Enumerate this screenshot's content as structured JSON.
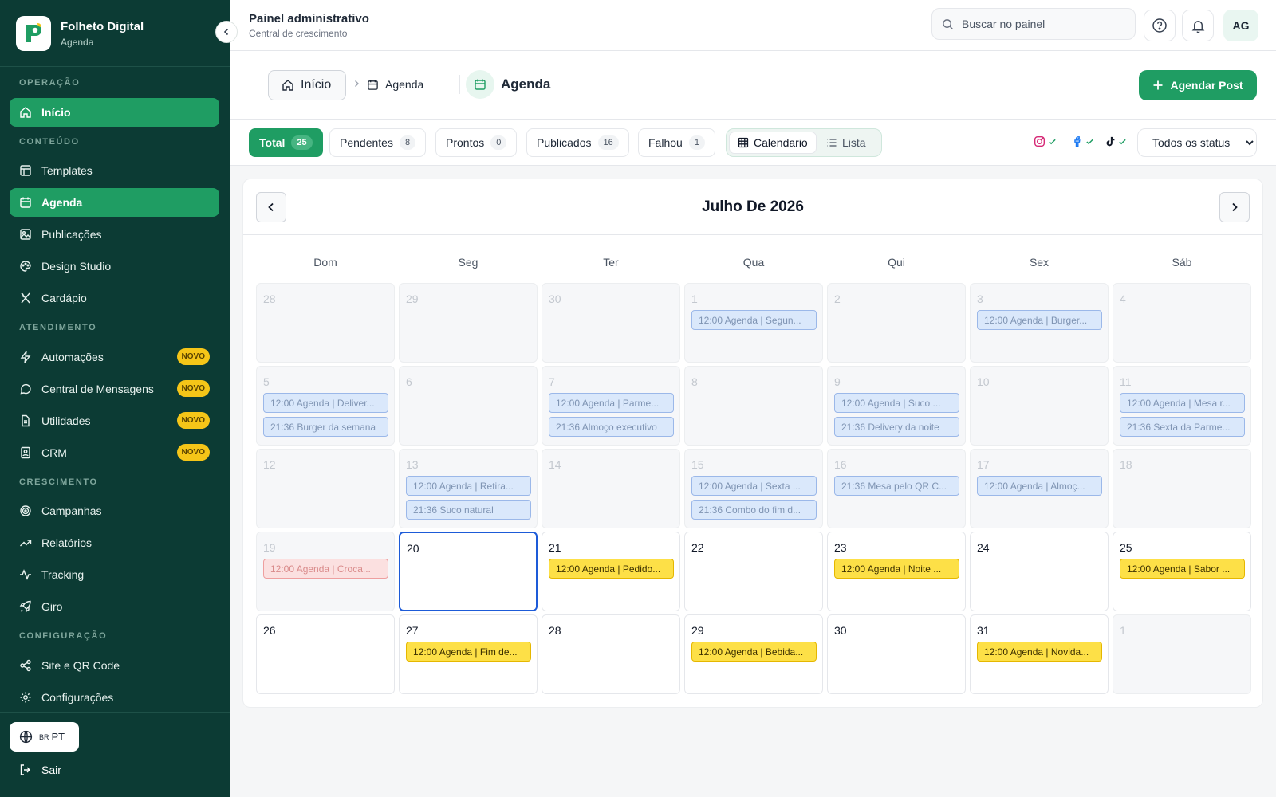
{
  "sidebar": {
    "brand_title": "Folheto Digital",
    "brand_sub": "Agenda",
    "sections": {
      "operacao": "OPERAÇÃO",
      "conteudo": "CONTEÚDO",
      "atendimento": "ATENDIMENTO",
      "crescimento": "CRESCIMENTO",
      "configuracao": "CONFIGURAÇÃO"
    },
    "items": {
      "inicio": "Início",
      "templates": "Templates",
      "agenda": "Agenda",
      "publicacoes": "Publicações",
      "design_studio": "Design Studio",
      "cardapio": "Cardápio",
      "automacoes": "Automações",
      "central_mensagens": "Central de Mensagens",
      "utilidades": "Utilidades",
      "crm": "CRM",
      "campanhas": "Campanhas",
      "relatorios": "Relatórios",
      "tracking": "Tracking",
      "giro": "Giro",
      "site_qr": "Site e QR Code",
      "configuracoes": "Configurações"
    },
    "badge_novo": "NOVO",
    "lang_flag": "BR",
    "lang_code": "PT",
    "logout": "Sair"
  },
  "header": {
    "title": "Painel administrativo",
    "subtitle": "Central de crescimento",
    "search_placeholder": "Buscar no painel",
    "avatar": "AG"
  },
  "subheader": {
    "crumb_home": "Início",
    "crumb_current": "Agenda",
    "page_title": "Agenda",
    "primary_button": "Agendar Post"
  },
  "filters": {
    "total_label": "Total",
    "total_count": "25",
    "pendentes_label": "Pendentes",
    "pendentes_count": "8",
    "prontos_label": "Prontos",
    "prontos_count": "0",
    "publicados_label": "Publicados",
    "publicados_count": "16",
    "falhou_label": "Falhou",
    "falhou_count": "1",
    "view_calendar": "Calendario",
    "view_list": "Lista",
    "status_selected": "Todos os status"
  },
  "calendar": {
    "month_title": "Julho De 2026",
    "weekdays": [
      "Dom",
      "Seg",
      "Ter",
      "Qua",
      "Qui",
      "Sex",
      "Sáb"
    ],
    "days": [
      {
        "num": "28",
        "state": "other",
        "events": []
      },
      {
        "num": "29",
        "state": "other",
        "events": []
      },
      {
        "num": "30",
        "state": "other",
        "events": []
      },
      {
        "num": "1",
        "state": "past",
        "events": [
          {
            "text": "12:00 Agenda | Segun...",
            "color": "blue"
          }
        ]
      },
      {
        "num": "2",
        "state": "past",
        "events": []
      },
      {
        "num": "3",
        "state": "past",
        "events": [
          {
            "text": "12:00 Agenda | Burger...",
            "color": "blue"
          }
        ]
      },
      {
        "num": "4",
        "state": "past",
        "events": []
      },
      {
        "num": "5",
        "state": "past",
        "events": [
          {
            "text": "12:00 Agenda | Deliver...",
            "color": "blue"
          },
          {
            "text": "21:36 Burger da semana",
            "color": "blue"
          }
        ]
      },
      {
        "num": "6",
        "state": "past",
        "events": []
      },
      {
        "num": "7",
        "state": "past",
        "events": [
          {
            "text": "12:00 Agenda | Parme...",
            "color": "blue"
          },
          {
            "text": "21:36 Almoço executivo",
            "color": "blue"
          }
        ]
      },
      {
        "num": "8",
        "state": "past",
        "events": []
      },
      {
        "num": "9",
        "state": "past",
        "events": [
          {
            "text": "12:00 Agenda | Suco ...",
            "color": "blue"
          },
          {
            "text": "21:36 Delivery da noite",
            "color": "blue"
          }
        ]
      },
      {
        "num": "10",
        "state": "past",
        "events": []
      },
      {
        "num": "11",
        "state": "past",
        "events": [
          {
            "text": "12:00 Agenda | Mesa r...",
            "color": "blue"
          },
          {
            "text": "21:36 Sexta da Parme...",
            "color": "blue"
          }
        ]
      },
      {
        "num": "12",
        "state": "past",
        "events": []
      },
      {
        "num": "13",
        "state": "past",
        "events": [
          {
            "text": "12:00 Agenda | Retira...",
            "color": "blue"
          },
          {
            "text": "21:36 Suco natural",
            "color": "blue"
          }
        ]
      },
      {
        "num": "14",
        "state": "past",
        "events": []
      },
      {
        "num": "15",
        "state": "past",
        "events": [
          {
            "text": "12:00 Agenda | Sexta ...",
            "color": "blue"
          },
          {
            "text": "21:36 Combo do fim d...",
            "color": "blue"
          }
        ]
      },
      {
        "num": "16",
        "state": "past",
        "events": [
          {
            "text": "21:36 Mesa pelo QR C...",
            "color": "blue"
          }
        ]
      },
      {
        "num": "17",
        "state": "past",
        "events": [
          {
            "text": "12:00 Agenda | Almoç...",
            "color": "blue"
          }
        ]
      },
      {
        "num": "18",
        "state": "past",
        "events": []
      },
      {
        "num": "19",
        "state": "past",
        "events": [
          {
            "text": "12:00 Agenda | Croca...",
            "color": "red"
          }
        ]
      },
      {
        "num": "20",
        "state": "today",
        "events": []
      },
      {
        "num": "21",
        "state": "current",
        "events": [
          {
            "text": "12:00 Agenda | Pedido...",
            "color": "yellow"
          }
        ]
      },
      {
        "num": "22",
        "state": "current",
        "events": []
      },
      {
        "num": "23",
        "state": "current",
        "events": [
          {
            "text": "12:00 Agenda | Noite ...",
            "color": "yellow"
          }
        ]
      },
      {
        "num": "24",
        "state": "current",
        "events": []
      },
      {
        "num": "25",
        "state": "current",
        "events": [
          {
            "text": "12:00 Agenda | Sabor ...",
            "color": "yellow"
          }
        ]
      },
      {
        "num": "26",
        "state": "current",
        "events": []
      },
      {
        "num": "27",
        "state": "current",
        "events": [
          {
            "text": "12:00 Agenda | Fim de...",
            "color": "yellow"
          }
        ]
      },
      {
        "num": "28",
        "state": "current",
        "events": []
      },
      {
        "num": "29",
        "state": "current",
        "events": [
          {
            "text": "12:00 Agenda | Bebida...",
            "color": "yellow"
          }
        ]
      },
      {
        "num": "30",
        "state": "current",
        "events": []
      },
      {
        "num": "31",
        "state": "current",
        "events": [
          {
            "text": "12:00 Agenda | Novida...",
            "color": "yellow"
          }
        ]
      },
      {
        "num": "1",
        "state": "other",
        "events": []
      }
    ]
  },
  "colors": {
    "sidebar_bg": "#0c3b34",
    "accent": "#1f9d63",
    "today_border": "#1d5bd8",
    "badge": "#f5c518"
  }
}
